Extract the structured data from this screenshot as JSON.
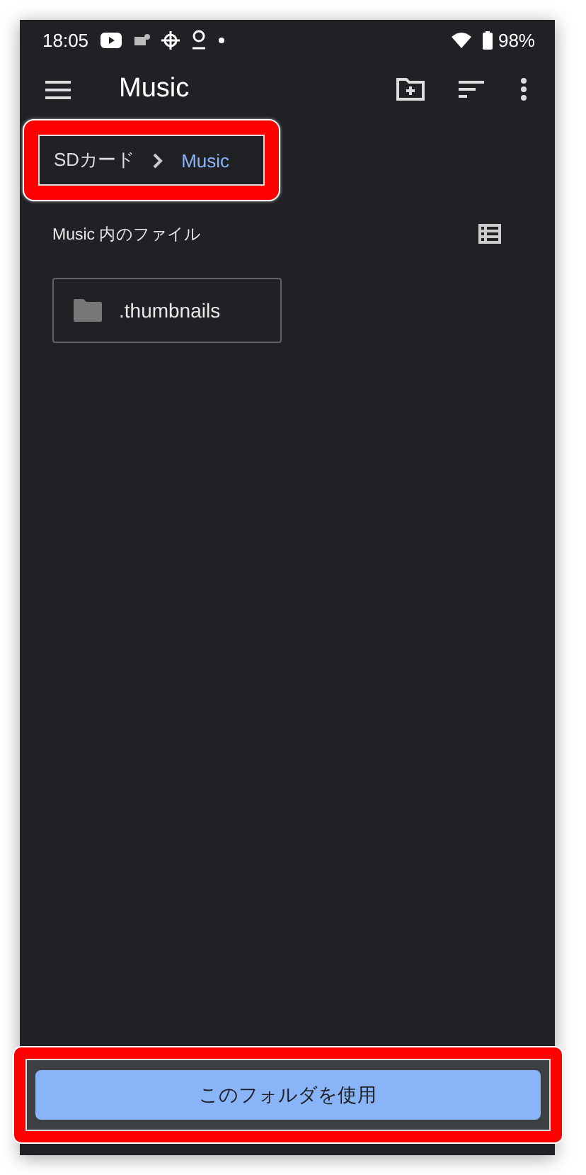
{
  "status_bar": {
    "time": "18:05",
    "battery": "98%"
  },
  "toolbar": {
    "title": "Music"
  },
  "breadcrumb": {
    "highlighted": true,
    "items": [
      {
        "label": "SDカード",
        "selected": false
      },
      {
        "label": "Music",
        "selected": true
      }
    ]
  },
  "section": {
    "title": "Music 内のファイル"
  },
  "folders": [
    {
      "name": ".thumbnails"
    }
  ],
  "bottom_bar": {
    "highlighted": true,
    "button": "このフォルダを使用"
  }
}
